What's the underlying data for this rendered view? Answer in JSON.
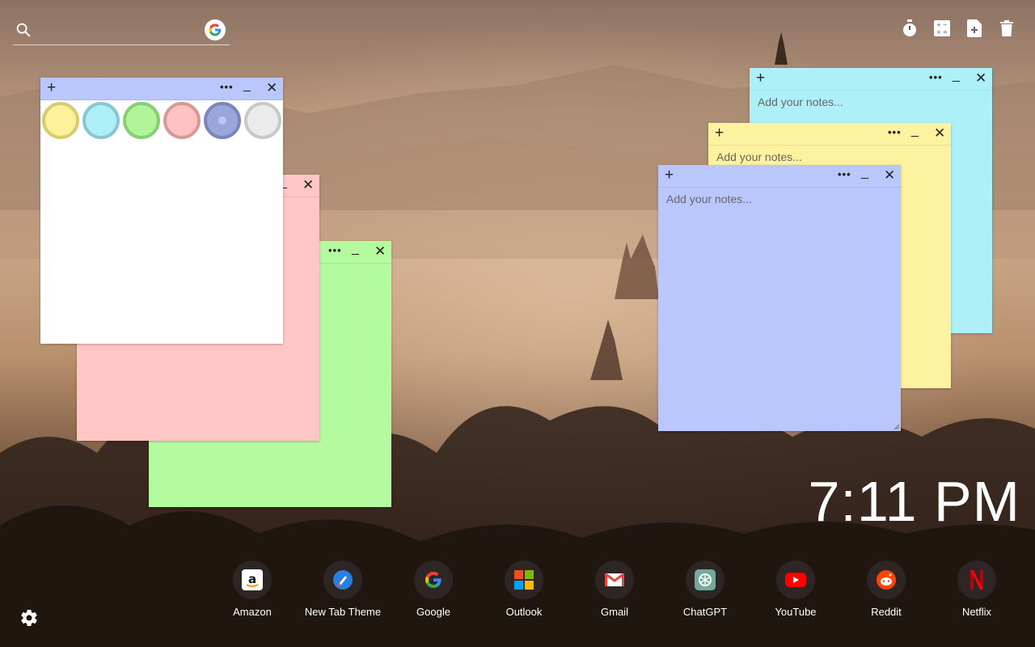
{
  "search": {
    "placeholder": "",
    "value": ""
  },
  "toolbar": {
    "icons": [
      "stopwatch-icon",
      "calculator-icon",
      "add-note-icon",
      "trash-icon"
    ]
  },
  "notes": {
    "placeholder": "Add your notes...",
    "plus_label": "+",
    "more_label": "•••",
    "min_label": "_",
    "close_label": "✕"
  },
  "palette": {
    "swatches": [
      {
        "fill": "#fcf09a",
        "border": "#d8cc70"
      },
      {
        "fill": "#aeeff7",
        "border": "#88c6d4"
      },
      {
        "fill": "#b0f59a",
        "border": "#86cf74"
      },
      {
        "fill": "#ffc2c2",
        "border": "#d49a9a"
      },
      {
        "fill": "#9aa6d9",
        "border": "#7a86b9"
      },
      {
        "fill": "#ebebeb",
        "border": "#c8c8c8"
      }
    ]
  },
  "colors": {
    "white": "#ffffff",
    "pink": "#ffc6c6",
    "green": "#b3fb9e",
    "cyan": "#aef0f8",
    "yellow": "#fdf2a0",
    "blue": "#b9c7fd"
  },
  "clock": {
    "time": "7:11 PM"
  },
  "shortcuts": [
    {
      "label": "Amazon",
      "icon": "amazon-icon"
    },
    {
      "label": "New Tab Theme",
      "icon": "new-tab-theme-icon"
    },
    {
      "label": "Google",
      "icon": "google-icon"
    },
    {
      "label": "Outlook",
      "icon": "outlook-icon"
    },
    {
      "label": "Gmail",
      "icon": "gmail-icon"
    },
    {
      "label": "ChatGPT",
      "icon": "chatgpt-icon"
    },
    {
      "label": "YouTube",
      "icon": "youtube-icon"
    },
    {
      "label": "Reddit",
      "icon": "reddit-icon"
    },
    {
      "label": "Netflix",
      "icon": "netflix-icon"
    }
  ],
  "settings": {
    "icon": "gear-icon"
  }
}
